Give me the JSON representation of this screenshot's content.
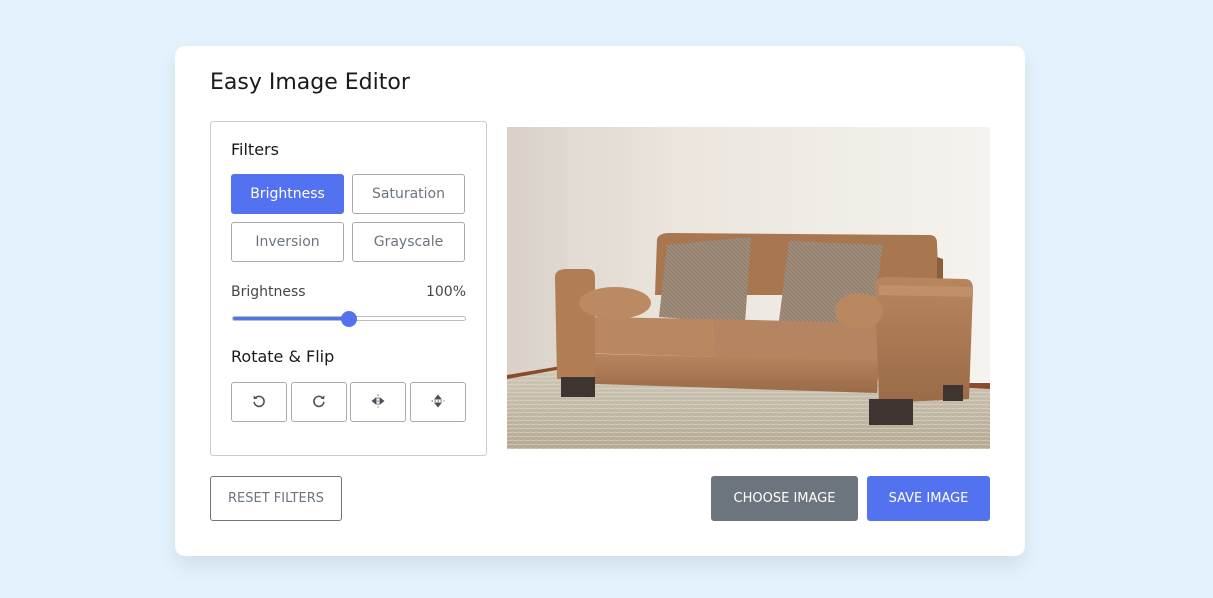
{
  "app": {
    "title": "Easy Image Editor"
  },
  "filters": {
    "label": "Filters",
    "buttons": [
      {
        "label": "Brightness",
        "active": true
      },
      {
        "label": "Saturation",
        "active": false
      },
      {
        "label": "Inversion",
        "active": false
      },
      {
        "label": "Grayscale",
        "active": false
      }
    ]
  },
  "slider": {
    "name": "Brightness",
    "value_text": "100%",
    "value": 100,
    "max": 200
  },
  "rotate": {
    "label": "Rotate & Flip",
    "buttons": [
      {
        "icon": "rotate-left-icon"
      },
      {
        "icon": "rotate-right-icon"
      },
      {
        "icon": "flip-horizontal-icon"
      },
      {
        "icon": "flip-vertical-icon"
      }
    ]
  },
  "preview": {
    "image": "brown-sofa-photo"
  },
  "actions": {
    "reset": "Reset Filters",
    "choose": "Choose Image",
    "save": "Save Image"
  },
  "colors": {
    "accent": "#5372f0",
    "secondary": "#6c757d",
    "background": "#e3f2fd"
  }
}
